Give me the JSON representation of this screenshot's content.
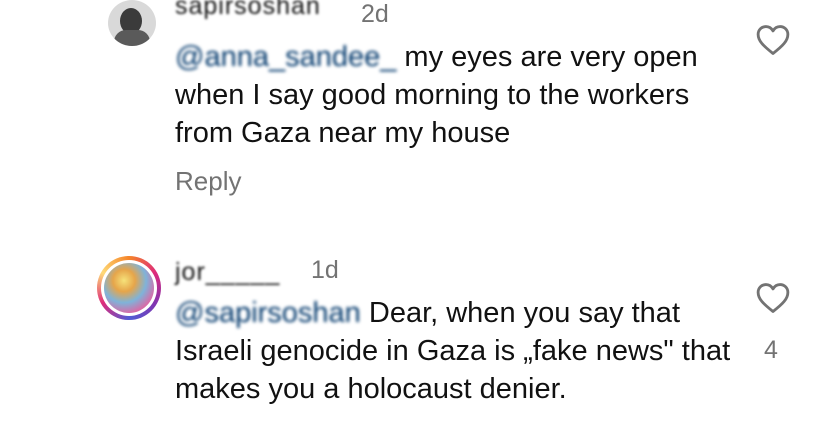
{
  "comments": [
    {
      "username": "sapirsoshan",
      "time": "2d",
      "mention": "@anna_sandee_",
      "text": " my eyes are very open when I say good morning to the workers from Gaza near my house",
      "reply_label": "Reply",
      "likes": ""
    },
    {
      "username": "jor_____",
      "time": "1d",
      "mention": "@sapirsoshan",
      "text": " Dear, when you say that Israeli genocide in Gaza is „fake news\" that makes you a holocaust denier.",
      "likes": "4"
    }
  ]
}
